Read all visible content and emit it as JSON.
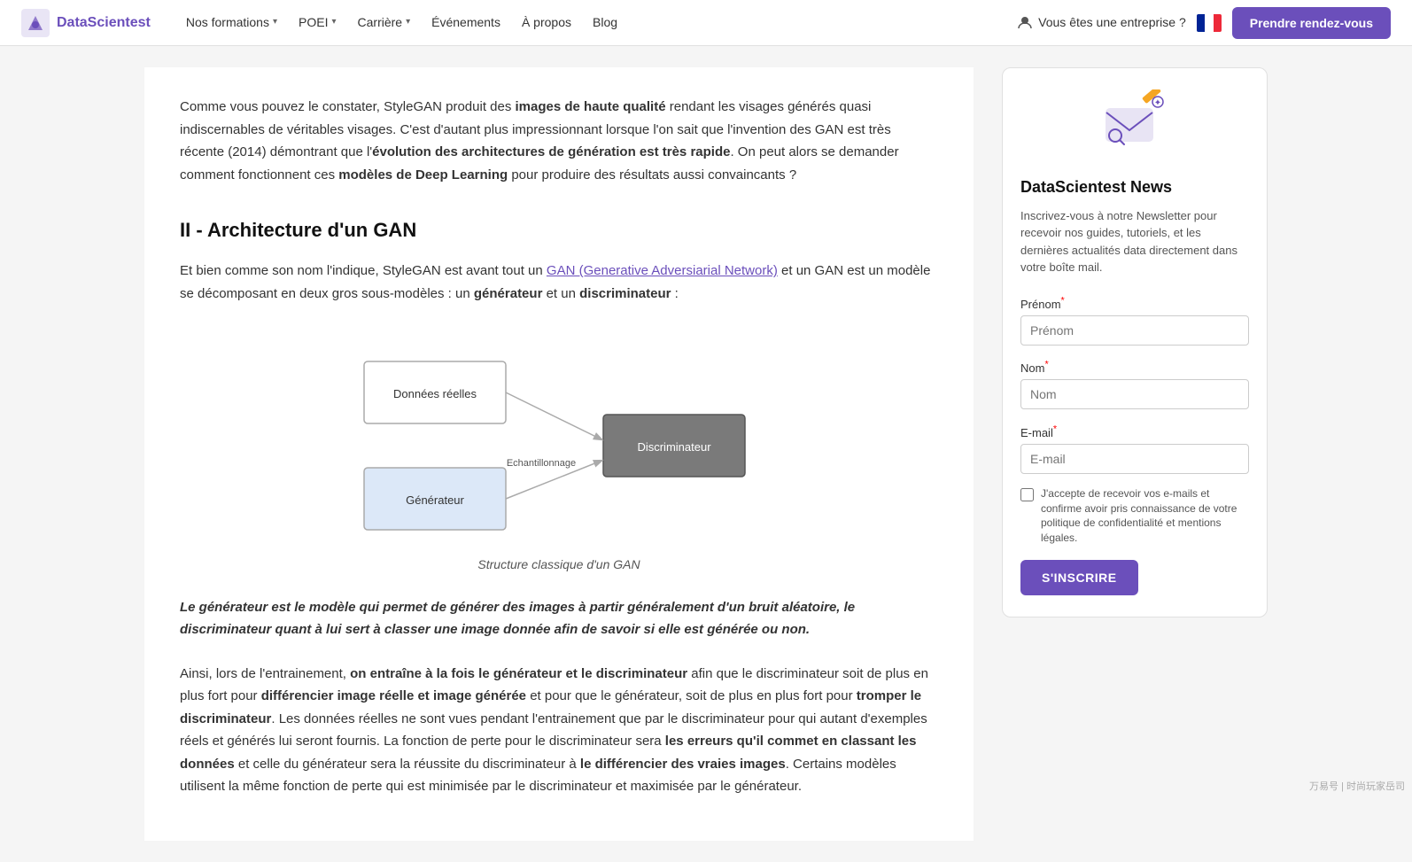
{
  "navbar": {
    "logo_text": "DataScientest",
    "nav_items": [
      {
        "label": "Nos formations",
        "has_dropdown": true
      },
      {
        "label": "POEI",
        "has_dropdown": true
      },
      {
        "label": "Carrière",
        "has_dropdown": true
      },
      {
        "label": "Événements",
        "has_dropdown": false
      },
      {
        "label": "À propos",
        "has_dropdown": false
      },
      {
        "label": "Blog",
        "has_dropdown": false
      }
    ],
    "enterprise_label": "Vous êtes une entreprise ?",
    "cta_label": "Prendre rendez-vous"
  },
  "article": {
    "intro_parts": [
      {
        "text": "Comme vous pouvez le constater, StyleGAN produit des ",
        "bold": false
      },
      {
        "text": "images de haute qualité",
        "bold": true
      },
      {
        "text": " rendant les visages générés quasi indiscernables de véritables visages. C'est d'autant plus impressionnant lorsque l'on sait que l'invention des GAN est très récente (2014) démontrant que l'",
        "bold": false
      },
      {
        "text": "évolution des architectures de génération est très rapide",
        "bold": true
      },
      {
        "text": ". On peut alors se demander comment fonctionnent ces ",
        "bold": false
      },
      {
        "text": "modèles de Deep Learning",
        "bold": true
      },
      {
        "text": " pour produire des résultats aussi convaincants ?",
        "bold": false
      }
    ],
    "section_heading": "II - Architecture d'un GAN",
    "body_text_1_parts": [
      {
        "text": "Et bien comme son nom l'indique, StyleGAN est avant tout un ",
        "bold": false,
        "link": false
      },
      {
        "text": "GAN (Generative Adversiarial Network)",
        "bold": false,
        "link": true
      },
      {
        "text": " et un GAN est un modèle se décomposant en deux gros sous-modèles : un ",
        "bold": false,
        "link": false
      },
      {
        "text": "générateur",
        "bold": true,
        "link": false
      },
      {
        "text": " et un ",
        "bold": false,
        "link": false
      },
      {
        "text": "discriminateur",
        "bold": true,
        "link": false
      },
      {
        "text": " :",
        "bold": false,
        "link": false
      }
    ],
    "diagram_caption": "Structure classique d'un GAN",
    "diagram": {
      "box1_label": "Données réelles",
      "box2_label": "Générateur",
      "box3_label": "Discriminateur",
      "arrow_label": "Echantillonnage"
    },
    "callout": "Le générateur est le modèle qui permet de générer des images à partir généralement d'un bruit aléatoire, le discriminateur quant à lui sert à classer une image donnée afin de savoir si elle est générée ou non.",
    "body_text_2_parts": [
      {
        "text": "Ainsi, lors de l'entrainement, ",
        "bold": false
      },
      {
        "text": "on entraîne à la fois le générateur et le discriminateur",
        "bold": true
      },
      {
        "text": " afin que le discriminateur soit de plus en plus fort pour ",
        "bold": false
      },
      {
        "text": "différencier image réelle et image générée",
        "bold": true
      },
      {
        "text": " et pour que le générateur, soit de plus en plus fort pour ",
        "bold": false
      },
      {
        "text": "tromper le discriminateur",
        "bold": true
      },
      {
        "text": ". Les données réelles ne sont vues pendant l'entrainement que par le discriminateur pour qui autant d'exemples réels et générés lui seront fournis. La fonction de perte pour le discriminateur sera ",
        "bold": false
      },
      {
        "text": "les erreurs qu'il commet en classant les données",
        "bold": true
      },
      {
        "text": " et celle du générateur sera la réussite du discriminateur à ",
        "bold": false
      },
      {
        "text": "le différencier des vraies images",
        "bold": true
      },
      {
        "text": ". Certains modèles utilisent la même fonction de perte qui est minimisée par le discriminateur et maximisée par le générateur.",
        "bold": false
      }
    ]
  },
  "sidebar": {
    "title": "DataScientest News",
    "description": "Inscrivez-vous à notre Newsletter pour recevoir nos guides, tutoriels, et les dernières actualités data directement dans votre boîte mail.",
    "form": {
      "prenom_label": "Prénom",
      "prenom_required": true,
      "nom_label": "Nom",
      "nom_required": true,
      "email_label": "E-mail",
      "email_required": true,
      "checkbox_label": "J'accepte de recevoir vos e-mails et confirme avoir pris connaissance de votre politique de confidentialité et mentions légales.",
      "submit_label": "S'INSCRIRE"
    }
  }
}
